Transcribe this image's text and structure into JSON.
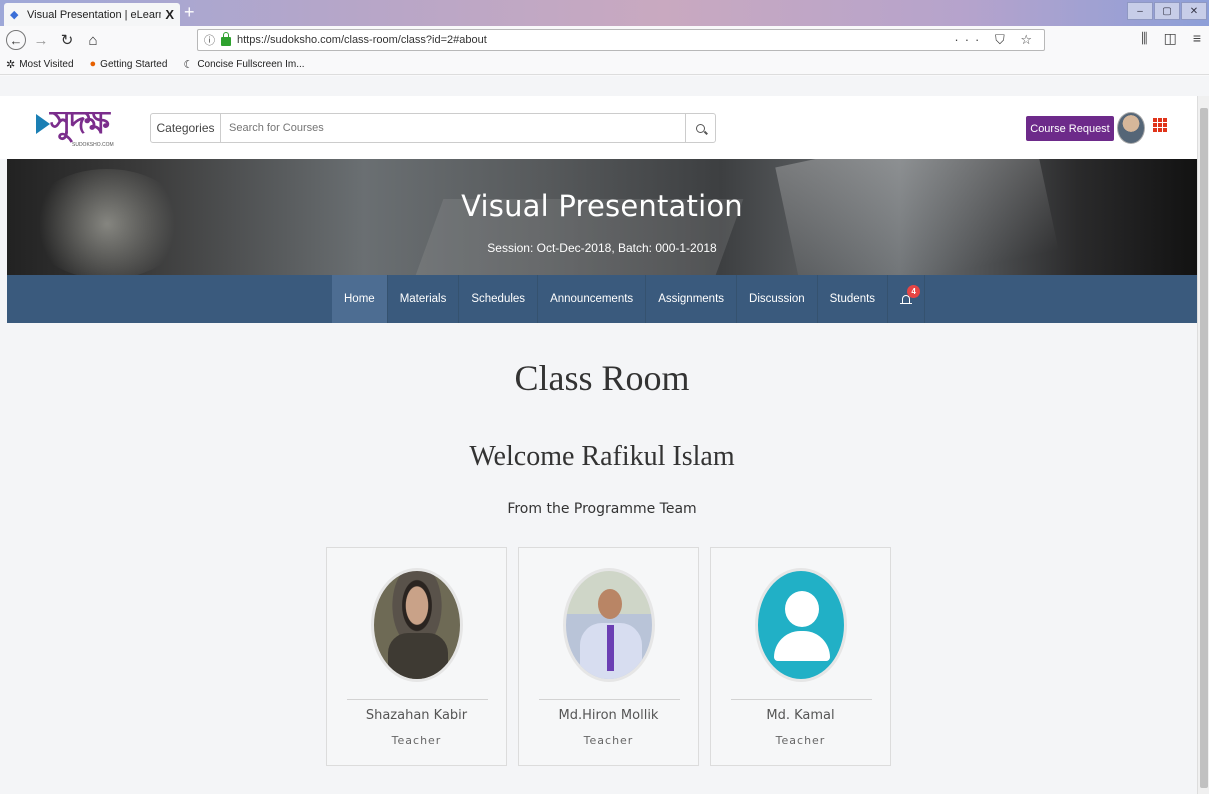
{
  "browser": {
    "tab_title": "Visual Presentation | eLearning",
    "tab_close": "X",
    "new_tab": "+",
    "url": "https://sudoksho.com/class-room/class?id=2#about",
    "page_actions": "··· ⛉ ☆",
    "bookmarks": [
      {
        "label": "Most Visited",
        "icon": "gear-icon"
      },
      {
        "label": "Getting Started",
        "icon": "firefox-icon"
      },
      {
        "label": "Concise Fullscreen Im...",
        "icon": "c-icon"
      }
    ]
  },
  "header": {
    "logo_text": "সুদক্ষ",
    "logo_sub": "SUDOKSHO.COM",
    "categories_label": "Categories",
    "search_placeholder": "Search for Courses",
    "course_request_label": "Course Request"
  },
  "banner": {
    "title": "Visual Presentation",
    "session": "Session: Oct-Dec-2018, Batch: 000-1-2018"
  },
  "classnav": {
    "items": [
      "Home",
      "Materials",
      "Schedules",
      "Announcements",
      "Assignments",
      "Discussion",
      "Students"
    ],
    "active": "Home",
    "notification_count": "4"
  },
  "content": {
    "title": "Class Room",
    "welcome": "Welcome Rafikul Islam",
    "from": "From the Programme Team",
    "team": [
      {
        "name": "Shazahan Kabir",
        "role": "Teacher"
      },
      {
        "name": "Md.Hiron Mollik",
        "role": "Teacher"
      },
      {
        "name": "Md. Kamal",
        "role": "Teacher"
      }
    ]
  },
  "colors": {
    "accent": "#6d2a8a",
    "nav_bg": "#3a5a7d",
    "badge": "#e64545",
    "avatar_placeholder": "#21b0c6"
  }
}
